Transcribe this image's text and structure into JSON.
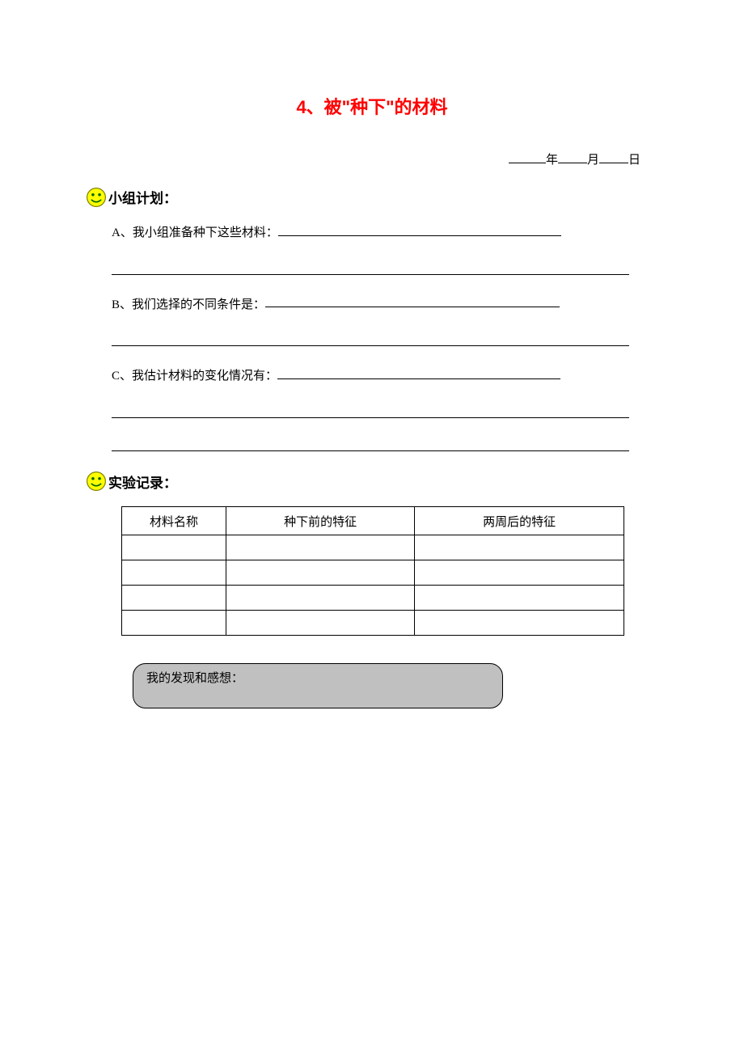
{
  "title": "4、被\"种下\"的材料",
  "date": {
    "year_label": "年",
    "month_label": "月",
    "day_label": "日"
  },
  "section1": {
    "heading": "小组计划：",
    "qA": "A、我小组准备种下这些材料：",
    "qB": "B、我们选择的不同条件是：",
    "qC": "C、我估计材料的变化情况有："
  },
  "section2": {
    "heading": "实验记录：",
    "table": {
      "headers": [
        "材料名称",
        "种下前的特征",
        "两周后的特征"
      ]
    }
  },
  "callout": {
    "label": "我的发现和感想："
  }
}
